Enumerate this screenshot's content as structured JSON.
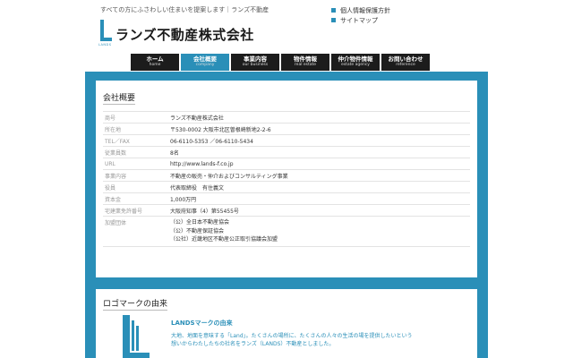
{
  "header": {
    "tagline": "すべての方にふさわしい住まいを提案します｜ランズ不動産",
    "logo_small": "LANDS",
    "logo_text": "ランズ不動産株式会社",
    "util_links": [
      "個人情報保護方針",
      "サイトマップ"
    ]
  },
  "nav": [
    {
      "jp": "ホーム",
      "en": "home",
      "active": false
    },
    {
      "jp": "会社概要",
      "en": "company",
      "active": true
    },
    {
      "jp": "事業内容",
      "en": "our business",
      "active": false
    },
    {
      "jp": "物件情報",
      "en": "real estate",
      "active": false
    },
    {
      "jp": "仲介物件情報",
      "en": "estate agency",
      "active": false
    },
    {
      "jp": "お問い合わせ",
      "en": "reference",
      "active": false
    }
  ],
  "company": {
    "title": "会社概要",
    "rows": [
      {
        "label": "商号",
        "value": "ランズ不動産株式会社"
      },
      {
        "label": "所在地",
        "value": "〒530-0002 大阪市北区曽根崎新地2-2-6"
      },
      {
        "label": "TEL／FAX",
        "value": "06-6110-5353 ／06-6110-5434"
      },
      {
        "label": "従業員数",
        "value": "8名"
      },
      {
        "label": "URL",
        "value": "http://www.lands-f.co.jp"
      },
      {
        "label": "事業内容",
        "value": "不動産の販売・仲介およびコンサルティング事業"
      },
      {
        "label": "役員",
        "value": "代表取締役　有住義文"
      },
      {
        "label": "資本金",
        "value": "1,000万円"
      },
      {
        "label": "宅建業免許番号",
        "value": "大阪府知事（4）第55455号"
      }
    ],
    "affiliation": {
      "label": "加盟団体",
      "values": [
        "（公）全日本不動産協会",
        "（公）不動産保証協会",
        "（公社）近畿地区不動産公正取引協議会加盟"
      ]
    }
  },
  "logo_origin": {
    "title": "ロゴマークの由来",
    "heading": "LANDSマークの由来",
    "description": "大地、地面を意味する「Land」。たくさんの場所に、たくさんの人々の生活の場を提供したいという想いからわたしたちの社名をランズ（LANDS）不動産としました。"
  },
  "colors": {
    "accent": "#2a8fb8",
    "nav_bg": "#1c1c1c"
  }
}
